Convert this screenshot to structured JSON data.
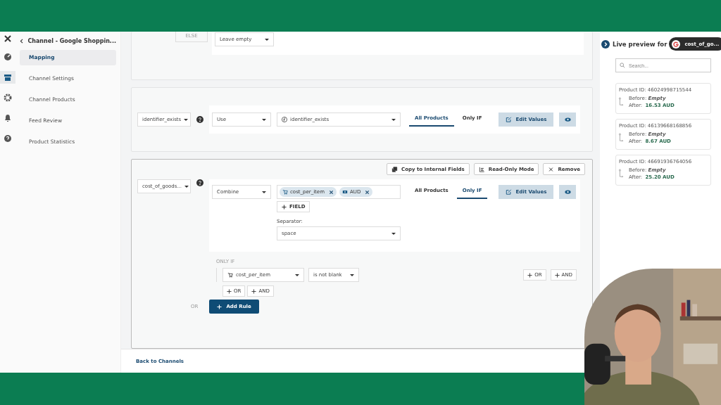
{
  "rail": [
    {
      "selected": false
    },
    {
      "selected": true
    },
    {
      "selected": false
    },
    {
      "selected": false
    },
    {
      "selected": false
    }
  ],
  "sidebar": {
    "title": "Channel - Google Shoppin...",
    "items": [
      {
        "label": "Mapping",
        "selected": true
      },
      {
        "label": "Channel Settings",
        "selected": false
      },
      {
        "label": "Channel Products",
        "selected": false
      },
      {
        "label": "Feed Review",
        "selected": false
      },
      {
        "label": "Product Statistics",
        "selected": false
      }
    ]
  },
  "else_block": {
    "label": "ELSE",
    "value": "Leave empty"
  },
  "identifier_rule": {
    "field": "identifier_exists",
    "method": "Use",
    "source": "identifier_exists",
    "tabs": [
      {
        "label": "All Products",
        "selected": true
      },
      {
        "label": "Only IF",
        "selected": false
      }
    ],
    "edit": "Edit Values"
  },
  "cost_rule": {
    "actions": [
      "Copy to Internal Fields",
      "Read-Only Mode",
      "Remove"
    ],
    "field": "cost_of_goods...",
    "method": "Combine",
    "chips": [
      "cost_per_item",
      "AUD"
    ],
    "add_field": "FIELD",
    "separator_label": "Separator:",
    "separator": "space",
    "tabs": [
      {
        "label": "All Products",
        "selected": false
      },
      {
        "label": "Only IF",
        "selected": true
      }
    ],
    "edit": "Edit Values",
    "condition": {
      "label": "ONLY IF",
      "field": "cost_per_item",
      "operator": "is not blank",
      "row_buttons": [
        "OR",
        "AND"
      ],
      "group_buttons": [
        "OR",
        "AND"
      ]
    },
    "or_label": "OR",
    "add_rule": "Add Rule"
  },
  "footer": {
    "link": "Back to Channels"
  },
  "preview": {
    "title": "Live preview for",
    "channel": "cost_of_go...",
    "placeholder": "Search...",
    "products": [
      {
        "id": "Product ID: 46024998715544",
        "before_label": "Before:",
        "before": "Empty",
        "after_label": "After:",
        "after": "16.53 AUD"
      },
      {
        "id": "Product ID: 46139668168856",
        "before_label": "Before:",
        "before": "Empty",
        "after_label": "After:",
        "after": "8.67 AUD"
      },
      {
        "id": "Product ID: 46691936764056",
        "before_label": "Before:",
        "before": "Empty",
        "after_label": "After:",
        "after": "25.20 AUD"
      }
    ]
  }
}
